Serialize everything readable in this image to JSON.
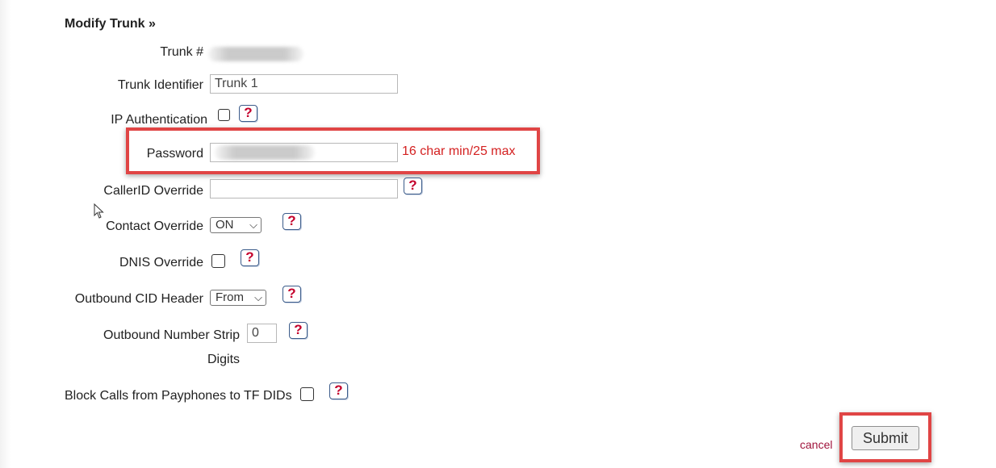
{
  "form": {
    "title": "Modify Trunk »",
    "trunk_number_label": "Trunk #",
    "trunk_identifier_label": "Trunk Identifier",
    "trunk_identifier_value": "Trunk 1",
    "ip_auth_label": "IP Authentication",
    "password_label": "Password",
    "password_hint": "16 char min/25 max",
    "callerid_override_label": "CallerID Override",
    "callerid_override_value": "",
    "contact_override_label": "Contact Override",
    "contact_override_selected": "ON",
    "dnis_override_label": "DNIS Override",
    "outbound_cid_header_label": "Outbound CID Header",
    "outbound_cid_header_selected": "From",
    "strip_digits_label_line1": "Outbound Number Strip",
    "strip_digits_label_line2": "Digits",
    "strip_digits_value": "0",
    "block_payphones_label": "Block Calls from Payphones to TF DIDs",
    "help_glyph": "?",
    "cancel_label": "cancel",
    "submit_label": "Submit"
  },
  "colors": {
    "highlight": "#e04545",
    "hint_text": "#d42121",
    "help_question": "#c4002b",
    "cancel_link": "#a0143c"
  },
  "icons": {
    "help": "question-mark-icon",
    "dropdown": "chevron-down-icon",
    "pointer": "mouse-cursor-icon"
  }
}
